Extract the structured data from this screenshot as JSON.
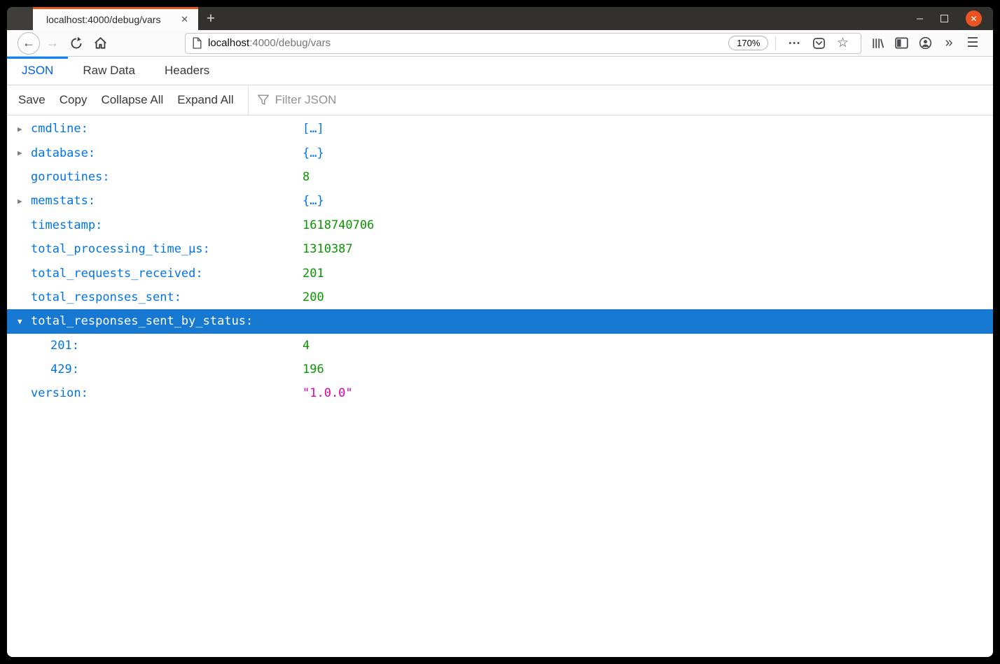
{
  "colors": {
    "accent_orange": "#e95420",
    "key_blue": "#0074e8",
    "number_green": "#0a9600",
    "string_magenta": "#dd00a9",
    "selection_blue": "#1778d2",
    "tab_active_blue": "#0060df",
    "tab_line_blue": "#0a84ff"
  },
  "window": {
    "tab_title": "localhost:4000/debug/vars",
    "icons": {
      "tab_close": "✕",
      "new_tab": "+",
      "minimize": "—",
      "close": "✕"
    }
  },
  "navbar": {
    "icons": {
      "back": "←",
      "forward": "→",
      "dots": "•••",
      "star": "☆",
      "chevrons": "»",
      "hamburger": "☰"
    },
    "url_host": "localhost",
    "url_path": ":4000/debug/vars",
    "zoom_level": "170%"
  },
  "viewer": {
    "tabs": [
      {
        "label": "JSON",
        "active": true
      },
      {
        "label": "Raw Data",
        "active": false
      },
      {
        "label": "Headers",
        "active": false
      }
    ],
    "toolbar": {
      "buttons": [
        "Save",
        "Copy",
        "Collapse All",
        "Expand All"
      ],
      "filter_placeholder": "Filter JSON"
    }
  },
  "json_rows": [
    {
      "marker": "▶",
      "key": "cmdline:",
      "value": "[…]",
      "value_type": "array",
      "indent": 0,
      "selected": false
    },
    {
      "marker": "▶",
      "key": "database:",
      "value": "{…}",
      "value_type": "object",
      "indent": 0,
      "selected": false
    },
    {
      "marker": "",
      "key": "goroutines:",
      "value": "8",
      "value_type": "number",
      "indent": 0,
      "selected": false
    },
    {
      "marker": "▶",
      "key": "memstats:",
      "value": "{…}",
      "value_type": "object",
      "indent": 0,
      "selected": false
    },
    {
      "marker": "",
      "key": "timestamp:",
      "value": "1618740706",
      "value_type": "number",
      "indent": 0,
      "selected": false
    },
    {
      "marker": "",
      "key": "total_processing_time_μs:",
      "value": "1310387",
      "value_type": "number",
      "indent": 0,
      "selected": false
    },
    {
      "marker": "",
      "key": "total_requests_received:",
      "value": "201",
      "value_type": "number",
      "indent": 0,
      "selected": false
    },
    {
      "marker": "",
      "key": "total_responses_sent:",
      "value": "200",
      "value_type": "number",
      "indent": 0,
      "selected": false
    },
    {
      "marker": "▼",
      "key": "total_responses_sent_by_status:",
      "value": null,
      "value_type": "",
      "indent": 0,
      "selected": true
    },
    {
      "marker": "",
      "key": "201:",
      "value": "4",
      "value_type": "number",
      "indent": 1,
      "selected": false
    },
    {
      "marker": "",
      "key": "429:",
      "value": "196",
      "value_type": "number",
      "indent": 1,
      "selected": false
    },
    {
      "marker": "",
      "key": "version:",
      "value": "\"1.0.0\"",
      "value_type": "string",
      "indent": 0,
      "selected": false
    }
  ]
}
